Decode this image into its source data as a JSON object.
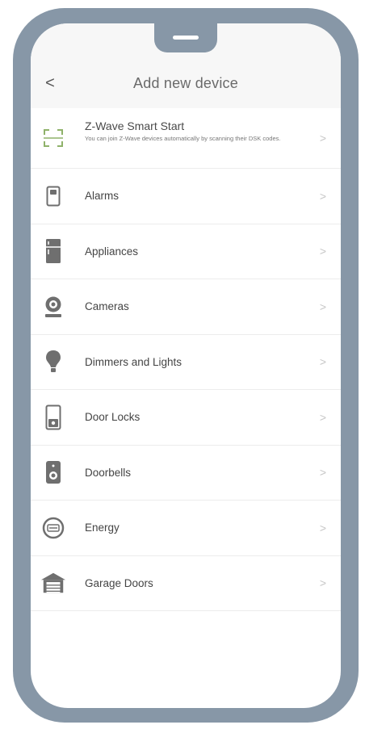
{
  "header": {
    "back_label": "<",
    "title": "Add new device"
  },
  "items": [
    {
      "label": "Z-Wave Smart Start",
      "subtitle": "You can join Z-Wave devices automatically by scanning their DSK codes.",
      "icon": "qr-scan-icon"
    },
    {
      "label": "Alarms",
      "icon": "alarm-icon"
    },
    {
      "label": "Appliances",
      "icon": "appliance-icon"
    },
    {
      "label": "Cameras",
      "icon": "camera-icon"
    },
    {
      "label": "Dimmers and Lights",
      "icon": "bulb-icon"
    },
    {
      "label": "Door Locks",
      "icon": "door-lock-icon"
    },
    {
      "label": "Doorbells",
      "icon": "doorbell-icon"
    },
    {
      "label": "Energy",
      "icon": "energy-meter-icon"
    },
    {
      "label": "Garage Doors",
      "icon": "garage-icon"
    }
  ],
  "colors": {
    "frame": "#8797a7",
    "accent_green": "#8fb26a",
    "icon_gray": "#6f6f6f",
    "chevron": "#c6c6c6"
  }
}
